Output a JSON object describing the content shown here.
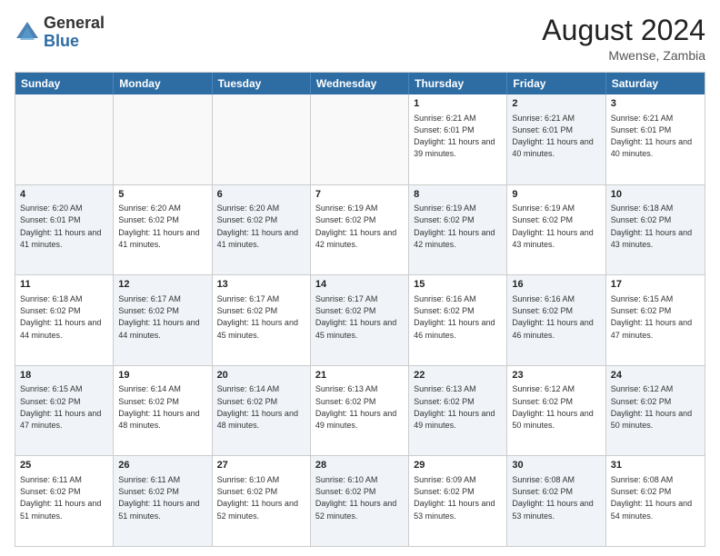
{
  "logo": {
    "general": "General",
    "blue": "Blue"
  },
  "header": {
    "month_year": "August 2024",
    "location": "Mwense, Zambia"
  },
  "days_of_week": [
    "Sunday",
    "Monday",
    "Tuesday",
    "Wednesday",
    "Thursday",
    "Friday",
    "Saturday"
  ],
  "weeks": [
    [
      {
        "day": "",
        "empty": true
      },
      {
        "day": "",
        "empty": true
      },
      {
        "day": "",
        "empty": true
      },
      {
        "day": "",
        "empty": true
      },
      {
        "day": "1",
        "sunrise": "Sunrise: 6:21 AM",
        "sunset": "Sunset: 6:01 PM",
        "daylight": "Daylight: 11 hours and 39 minutes.",
        "shaded": false
      },
      {
        "day": "2",
        "sunrise": "Sunrise: 6:21 AM",
        "sunset": "Sunset: 6:01 PM",
        "daylight": "Daylight: 11 hours and 40 minutes.",
        "shaded": true
      },
      {
        "day": "3",
        "sunrise": "Sunrise: 6:21 AM",
        "sunset": "Sunset: 6:01 PM",
        "daylight": "Daylight: 11 hours and 40 minutes.",
        "shaded": false
      }
    ],
    [
      {
        "day": "4",
        "sunrise": "Sunrise: 6:20 AM",
        "sunset": "Sunset: 6:01 PM",
        "daylight": "Daylight: 11 hours and 41 minutes.",
        "shaded": true
      },
      {
        "day": "5",
        "sunrise": "Sunrise: 6:20 AM",
        "sunset": "Sunset: 6:02 PM",
        "daylight": "Daylight: 11 hours and 41 minutes.",
        "shaded": false
      },
      {
        "day": "6",
        "sunrise": "Sunrise: 6:20 AM",
        "sunset": "Sunset: 6:02 PM",
        "daylight": "Daylight: 11 hours and 41 minutes.",
        "shaded": true
      },
      {
        "day": "7",
        "sunrise": "Sunrise: 6:19 AM",
        "sunset": "Sunset: 6:02 PM",
        "daylight": "Daylight: 11 hours and 42 minutes.",
        "shaded": false
      },
      {
        "day": "8",
        "sunrise": "Sunrise: 6:19 AM",
        "sunset": "Sunset: 6:02 PM",
        "daylight": "Daylight: 11 hours and 42 minutes.",
        "shaded": true
      },
      {
        "day": "9",
        "sunrise": "Sunrise: 6:19 AM",
        "sunset": "Sunset: 6:02 PM",
        "daylight": "Daylight: 11 hours and 43 minutes.",
        "shaded": false
      },
      {
        "day": "10",
        "sunrise": "Sunrise: 6:18 AM",
        "sunset": "Sunset: 6:02 PM",
        "daylight": "Daylight: 11 hours and 43 minutes.",
        "shaded": true
      }
    ],
    [
      {
        "day": "11",
        "sunrise": "Sunrise: 6:18 AM",
        "sunset": "Sunset: 6:02 PM",
        "daylight": "Daylight: 11 hours and 44 minutes.",
        "shaded": false
      },
      {
        "day": "12",
        "sunrise": "Sunrise: 6:17 AM",
        "sunset": "Sunset: 6:02 PM",
        "daylight": "Daylight: 11 hours and 44 minutes.",
        "shaded": true
      },
      {
        "day": "13",
        "sunrise": "Sunrise: 6:17 AM",
        "sunset": "Sunset: 6:02 PM",
        "daylight": "Daylight: 11 hours and 45 minutes.",
        "shaded": false
      },
      {
        "day": "14",
        "sunrise": "Sunrise: 6:17 AM",
        "sunset": "Sunset: 6:02 PM",
        "daylight": "Daylight: 11 hours and 45 minutes.",
        "shaded": true
      },
      {
        "day": "15",
        "sunrise": "Sunrise: 6:16 AM",
        "sunset": "Sunset: 6:02 PM",
        "daylight": "Daylight: 11 hours and 46 minutes.",
        "shaded": false
      },
      {
        "day": "16",
        "sunrise": "Sunrise: 6:16 AM",
        "sunset": "Sunset: 6:02 PM",
        "daylight": "Daylight: 11 hours and 46 minutes.",
        "shaded": true
      },
      {
        "day": "17",
        "sunrise": "Sunrise: 6:15 AM",
        "sunset": "Sunset: 6:02 PM",
        "daylight": "Daylight: 11 hours and 47 minutes.",
        "shaded": false
      }
    ],
    [
      {
        "day": "18",
        "sunrise": "Sunrise: 6:15 AM",
        "sunset": "Sunset: 6:02 PM",
        "daylight": "Daylight: 11 hours and 47 minutes.",
        "shaded": true
      },
      {
        "day": "19",
        "sunrise": "Sunrise: 6:14 AM",
        "sunset": "Sunset: 6:02 PM",
        "daylight": "Daylight: 11 hours and 48 minutes.",
        "shaded": false
      },
      {
        "day": "20",
        "sunrise": "Sunrise: 6:14 AM",
        "sunset": "Sunset: 6:02 PM",
        "daylight": "Daylight: 11 hours and 48 minutes.",
        "shaded": true
      },
      {
        "day": "21",
        "sunrise": "Sunrise: 6:13 AM",
        "sunset": "Sunset: 6:02 PM",
        "daylight": "Daylight: 11 hours and 49 minutes.",
        "shaded": false
      },
      {
        "day": "22",
        "sunrise": "Sunrise: 6:13 AM",
        "sunset": "Sunset: 6:02 PM",
        "daylight": "Daylight: 11 hours and 49 minutes.",
        "shaded": true
      },
      {
        "day": "23",
        "sunrise": "Sunrise: 6:12 AM",
        "sunset": "Sunset: 6:02 PM",
        "daylight": "Daylight: 11 hours and 50 minutes.",
        "shaded": false
      },
      {
        "day": "24",
        "sunrise": "Sunrise: 6:12 AM",
        "sunset": "Sunset: 6:02 PM",
        "daylight": "Daylight: 11 hours and 50 minutes.",
        "shaded": true
      }
    ],
    [
      {
        "day": "25",
        "sunrise": "Sunrise: 6:11 AM",
        "sunset": "Sunset: 6:02 PM",
        "daylight": "Daylight: 11 hours and 51 minutes.",
        "shaded": false
      },
      {
        "day": "26",
        "sunrise": "Sunrise: 6:11 AM",
        "sunset": "Sunset: 6:02 PM",
        "daylight": "Daylight: 11 hours and 51 minutes.",
        "shaded": true
      },
      {
        "day": "27",
        "sunrise": "Sunrise: 6:10 AM",
        "sunset": "Sunset: 6:02 PM",
        "daylight": "Daylight: 11 hours and 52 minutes.",
        "shaded": false
      },
      {
        "day": "28",
        "sunrise": "Sunrise: 6:10 AM",
        "sunset": "Sunset: 6:02 PM",
        "daylight": "Daylight: 11 hours and 52 minutes.",
        "shaded": true
      },
      {
        "day": "29",
        "sunrise": "Sunrise: 6:09 AM",
        "sunset": "Sunset: 6:02 PM",
        "daylight": "Daylight: 11 hours and 53 minutes.",
        "shaded": false
      },
      {
        "day": "30",
        "sunrise": "Sunrise: 6:08 AM",
        "sunset": "Sunset: 6:02 PM",
        "daylight": "Daylight: 11 hours and 53 minutes.",
        "shaded": true
      },
      {
        "day": "31",
        "sunrise": "Sunrise: 6:08 AM",
        "sunset": "Sunset: 6:02 PM",
        "daylight": "Daylight: 11 hours and 54 minutes.",
        "shaded": false
      }
    ]
  ]
}
